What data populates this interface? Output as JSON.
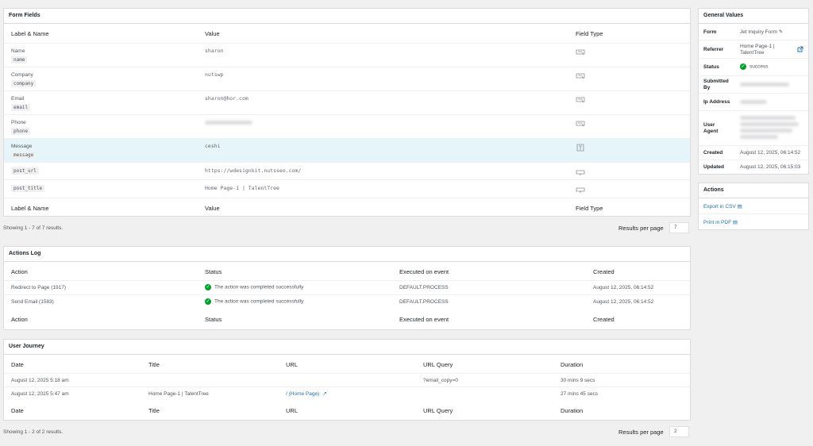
{
  "form_fields": {
    "title": "Form Fields",
    "headers": {
      "label": "Label & Name",
      "value": "Value",
      "type": "Field Type"
    },
    "rows": [
      {
        "label": "Name",
        "name": "name",
        "value": "sharon",
        "icon": "text-field-icon"
      },
      {
        "label": "Company",
        "name": "company",
        "value": "nutswp",
        "icon": "text-field-icon"
      },
      {
        "label": "Email",
        "name": "email",
        "value": "sharon@hor.com",
        "icon": "text-field-icon"
      },
      {
        "label": "Phone",
        "name": "phone",
        "value": "",
        "icon": "text-field-icon"
      },
      {
        "label": "Message",
        "name": "message",
        "value": "ceshi",
        "icon": "textarea-field-icon"
      },
      {
        "label": "",
        "name": "post_url",
        "value": "https://wdesignkit.nutsseo.com/",
        "icon": "hidden-field-icon"
      },
      {
        "label": "",
        "name": "post_title",
        "value": "Home Page-1 | TalentTree",
        "icon": "hidden-field-icon"
      }
    ],
    "showing": "Showing 1 - 7 of 7 results.",
    "results_per_page_label": "Results per page",
    "results_per_page": "7"
  },
  "actions_log": {
    "title": "Actions Log",
    "headers": {
      "action": "Action",
      "status": "Status",
      "event": "Executed on event",
      "created": "Created"
    },
    "rows": [
      {
        "action": "Redirect to Page (1917)",
        "status": "The action was completed successfully",
        "event": "DEFAULT.PROCESS",
        "created": "August 12, 2025, 06:14:52"
      },
      {
        "action": "Send Email (1583)",
        "status": "The action was completed successfully",
        "event": "DEFAULT.PROCESS",
        "created": "August 12, 2025, 06:14:52"
      }
    ]
  },
  "user_journey": {
    "title": "User Journey",
    "headers": {
      "date": "Date",
      "title": "Title",
      "url": "URL",
      "query": "URL Query",
      "duration": "Duration"
    },
    "rows": [
      {
        "date": "August 12, 2025 5:18 am",
        "title": "",
        "url": "",
        "query": "?email_copy=0",
        "duration": "30 mins 9 secs"
      },
      {
        "date": "August 12, 2025 5:47 am",
        "title": "Home Page-1 | TalentTree",
        "url": "/ (Home Page)",
        "query": "",
        "duration": "27 mins 45 secs"
      }
    ],
    "showing": "Showing 1 - 2 of 2 results.",
    "results_per_page_label": "Results per page",
    "results_per_page": "2"
  },
  "general_values": {
    "title": "General Values",
    "form_label": "Form",
    "form_value": "Jet Inquiry Form",
    "referrer_label": "Referrer",
    "referrer_value": "Home Page-1 | TalentTree",
    "status_label": "Status",
    "status_value": "success",
    "submitted_label": "Submitted By",
    "ip_label": "Ip Address",
    "agent_label": "User Agent",
    "created_label": "Created",
    "created_value": "August 12, 2025, 06:14:52",
    "updated_label": "Updated",
    "updated_value": "August 12, 2025, 06:15:03"
  },
  "actions": {
    "title": "Actions",
    "export_csv": "Export in CSV",
    "print_pdf": "Print in PDF"
  },
  "colors": {
    "link": "#2271b1",
    "success": "#00a32a",
    "highlight_row": "#e5f5fa"
  }
}
